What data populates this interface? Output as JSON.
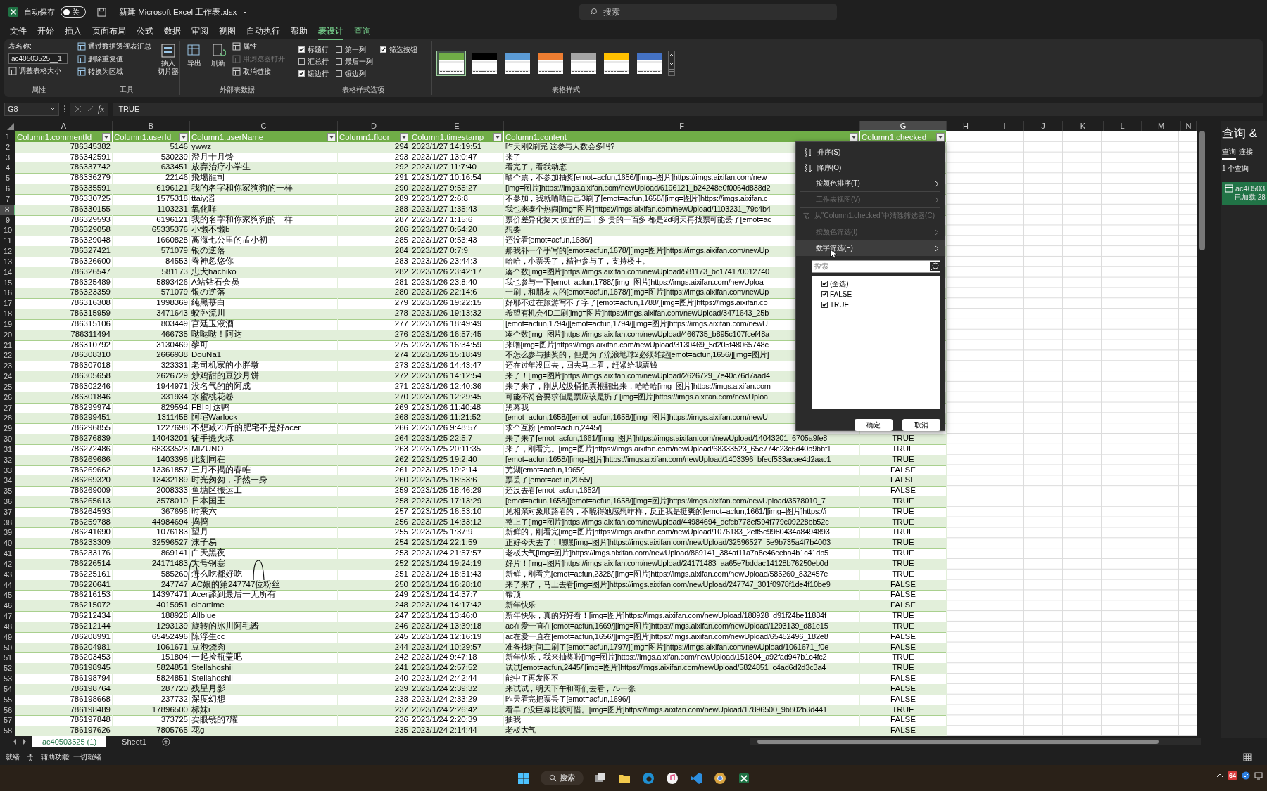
{
  "title_bar": {
    "autosave_label": "自动保存",
    "autosave_toggle": {
      "label": "关",
      "on": false
    },
    "file_title": "新建 Microsoft Excel 工作表.xlsx",
    "search_placeholder": "搜索"
  },
  "menu_tabs": [
    {
      "label": "文件",
      "selected": false,
      "contextual": false
    },
    {
      "label": "开始",
      "selected": false,
      "contextual": false
    },
    {
      "label": "插入",
      "selected": false,
      "contextual": false
    },
    {
      "label": "页面布局",
      "selected": false,
      "contextual": false
    },
    {
      "label": "公式",
      "selected": false,
      "contextual": false
    },
    {
      "label": "数据",
      "selected": false,
      "contextual": false
    },
    {
      "label": "审阅",
      "selected": false,
      "contextual": false
    },
    {
      "label": "视图",
      "selected": false,
      "contextual": false
    },
    {
      "label": "自动执行",
      "selected": false,
      "contextual": false
    },
    {
      "label": "帮助",
      "selected": false,
      "contextual": false
    },
    {
      "label": "表设计",
      "selected": true,
      "contextual": true
    },
    {
      "label": "查询",
      "selected": false,
      "contextual": true
    }
  ],
  "ribbon": {
    "properties_group": {
      "label": "属性",
      "table_name_label": "表名称:",
      "table_name": "ac40503525__1",
      "resize": "调整表格大小"
    },
    "tools_group": {
      "label": "工具",
      "items": [
        "通过数据透视表汇总",
        "删除重复值",
        "转换为区域"
      ],
      "slicer_lines": [
        "插入",
        "切片器"
      ]
    },
    "external_data_group": {
      "label": "外部表数据",
      "export": "导出",
      "refresh": "刷新",
      "items": [
        {
          "label": "属性",
          "disabled": false
        },
        {
          "label": "用浏览器打开",
          "disabled": true
        },
        {
          "label": "取消链接",
          "disabled": false
        }
      ]
    },
    "style_options_group": {
      "label": "表格样式选项",
      "options": [
        {
          "label": "标题行",
          "checked": true
        },
        {
          "label": "汇总行",
          "checked": false
        },
        {
          "label": "镶边行",
          "checked": true
        },
        {
          "label": "第一列",
          "checked": false
        },
        {
          "label": "最后一列",
          "checked": false
        },
        {
          "label": "镶边列",
          "checked": false
        },
        {
          "label": "筛选按钮",
          "checked": true
        }
      ]
    },
    "styles_group": {
      "label": "表格样式",
      "swatches": [
        {
          "color": "#70ad47",
          "selected": true
        },
        {
          "color": "#000000",
          "selected": false
        },
        {
          "color": "#5b9bd5",
          "selected": false
        },
        {
          "color": "#ed7d31",
          "selected": false
        },
        {
          "color": "#a5a5a5",
          "selected": false
        },
        {
          "color": "#ffc000",
          "selected": false
        },
        {
          "color": "#4472c4",
          "selected": false
        }
      ]
    }
  },
  "formula_bar": {
    "name_box": "G8",
    "function_label": "fx",
    "formula": "TRUE"
  },
  "column_letters": [
    {
      "letter": "A",
      "selected": false
    },
    {
      "letter": "B",
      "selected": false
    },
    {
      "letter": "C",
      "selected": false
    },
    {
      "letter": "D",
      "selected": false
    },
    {
      "letter": "E",
      "selected": false
    },
    {
      "letter": "F",
      "selected": false
    },
    {
      "letter": "G",
      "selected": true
    },
    {
      "letter": "H",
      "selected": false
    },
    {
      "letter": "I",
      "selected": false
    },
    {
      "letter": "J",
      "selected": false
    },
    {
      "letter": "K",
      "selected": false
    },
    {
      "letter": "L",
      "selected": false
    },
    {
      "letter": "M",
      "selected": false
    },
    {
      "letter": "N",
      "selected": false
    }
  ],
  "table": {
    "header_row_number": "1",
    "columns": [
      "Column1.commentId",
      "Column1.userId",
      "Column1.userName",
      "Column1.floor",
      "Column1.timestamp",
      "Column1.content",
      "Column1.checked"
    ],
    "rows": [
      {
        "number": "2",
        "selected": false,
        "cells": [
          "786345382",
          "5146",
          "ywwz",
          "294",
          "2023/1/27 14:19:51",
          "昨天刚2刷完 这参与人数会多吗?"
        ]
      },
      {
        "number": "3",
        "selected": false,
        "cells": [
          "786342591",
          "530239",
          "澄月十月铃",
          "293",
          "2023/1/27 13:0:47",
          "来了"
        ]
      },
      {
        "number": "4",
        "selected": false,
        "cells": [
          "786337742",
          "633451",
          "放弃治疗小学生",
          "292",
          "2023/1/27 11:7:40",
          "看完了，看我动态"
        ]
      },
      {
        "number": "5",
        "selected": false,
        "cells": [
          "786336279",
          "22146",
          "飛場龍司",
          "291",
          "2023/1/27 10:16:54",
          "晒个票，不参加抽奖[emot=acfun,1656/][img=图片]https://imgs.aixifan.com/new"
        ]
      },
      {
        "number": "6",
        "selected": false,
        "cells": [
          "786335591",
          "6196121",
          "我的名字和你家狗狗的一样",
          "290",
          "2023/1/27 9:55:27",
          "[img=图片]https://imgs.aixifan.com/newUpload/6196121_b24248e0f0064d838d2"
        ]
      },
      {
        "number": "7",
        "selected": false,
        "cells": [
          "786330725",
          "1575318",
          "ttaiy滔",
          "289",
          "2023/1/27 2:6:8",
          "不参加，我就晒晒自己3刷了[emot=acfun,1658/][img=图片]https://imgs.aixifan.c"
        ]
      },
      {
        "number": "8",
        "selected": true,
        "cells": [
          "786330155",
          "1103231",
          "氧化咩",
          "288",
          "2023/1/27 1:35:43",
          "我也来凑个热闹[img=图片]https://imgs.aixifan.com/newUpload/1103231_79c4b4"
        ]
      },
      {
        "number": "9",
        "selected": false,
        "cells": [
          "786329593",
          "6196121",
          "我的名字和你家狗狗的一样",
          "287",
          "2023/1/27 1:15:6",
          "票价差异化挺大 便宜的三十多 贵的一百多 都是2d明天再找票可能丢了[emot=ac"
        ]
      },
      {
        "number": "10",
        "selected": false,
        "cells": [
          "786329058",
          "65335376",
          "小懒不懒b",
          "286",
          "2023/1/27 0:54:20",
          "想要"
        ]
      },
      {
        "number": "11",
        "selected": false,
        "cells": [
          "786329048",
          "1660828",
          "离海七公里的孟小初",
          "285",
          "2023/1/27 0:53:43",
          "还没看[emot=acfun,1686/]"
        ]
      },
      {
        "number": "12",
        "selected": false,
        "cells": [
          "786327421",
          "571079",
          "银の逆落",
          "284",
          "2023/1/27 0:7:9",
          "那我补一个手写的[emot=acfun,1678/][img=图片]https://imgs.aixifan.com/newUp"
        ]
      },
      {
        "number": "13",
        "selected": false,
        "cells": [
          "786326600",
          "84553",
          "春神忽悠你",
          "283",
          "2023/1/26 23:44:3",
          "哈哈，小票丢了，精神参与了，支持楼主。"
        ]
      },
      {
        "number": "14",
        "selected": false,
        "cells": [
          "786326547",
          "581173",
          "忠犬hachiko",
          "282",
          "2023/1/26 23:42:17",
          "凑个数[img=图片]https://imgs.aixifan.com/newUpload/581173_bc174170012740"
        ]
      },
      {
        "number": "15",
        "selected": false,
        "cells": [
          "786325489",
          "5893426",
          "A站钻石会员",
          "281",
          "2023/1/26 23:8:40",
          "我也参与一下[emot=acfun,1788/][img=图片]https://imgs.aixifan.com/newUploa"
        ]
      },
      {
        "number": "16",
        "selected": false,
        "cells": [
          "786323359",
          "571079",
          "银の逆落",
          "280",
          "2023/1/26 22:14:6",
          "一刷，和朋友去的[emot=acfun,1678/][img=图片]https://imgs.aixifan.com/newUp"
        ]
      },
      {
        "number": "17",
        "selected": false,
        "cells": [
          "786316308",
          "1998369",
          "纯黑慕白",
          "279",
          "2023/1/26 19:22:15",
          "好耶不过在旅游写不了字了[emot=acfun,1788/][img=图片]https://imgs.aixifan.co"
        ]
      },
      {
        "number": "18",
        "selected": false,
        "cells": [
          "786315959",
          "3471643",
          "蛟卧流川",
          "278",
          "2023/1/26 19:13:32",
          "希望有机会4D二刷[img=图片]https://imgs.aixifan.com/newUpload/3471643_25b"
        ]
      },
      {
        "number": "19",
        "selected": false,
        "cells": [
          "786315106",
          "803449",
          "宫廷玉液酒",
          "277",
          "2023/1/26 18:49:49",
          "[emot=acfun,1794/][emot=acfun,1794/][img=图片]https://imgs.aixifan.com/newU"
        ]
      },
      {
        "number": "20",
        "selected": false,
        "cells": [
          "786311494",
          "466735",
          "哒哒哒！阿达",
          "276",
          "2023/1/26 16:57:45",
          "凑个数[img=图片]https://imgs.aixifan.com/newUpload/466735_b895c107fcef48a"
        ]
      },
      {
        "number": "21",
        "selected": false,
        "cells": [
          "786310792",
          "3130469",
          "黎可",
          "275",
          "2023/1/26 16:34:59",
          "来噜[img=图片]https://imgs.aixifan.com/newUpload/3130469_5d205f48065748c"
        ]
      },
      {
        "number": "22",
        "selected": false,
        "cells": [
          "786308310",
          "2666938",
          "DouNa1",
          "274",
          "2023/1/26 15:18:49",
          "不怎么参与抽奖的，但是为了流浪地球2必须雄起[emot=acfun,1656/][img=图片]"
        ]
      },
      {
        "number": "23",
        "selected": false,
        "cells": [
          "786307018",
          "323331",
          "老司机家的小胖墩",
          "273",
          "2023/1/26 14:43:47",
          "还在过年没回去，回去马上看，赶紧给我票钱"
        ]
      },
      {
        "number": "24",
        "selected": false,
        "cells": [
          "786305658",
          "2626729",
          "炒鸡甜的豆沙月饼",
          "272",
          "2023/1/26 14:12:54",
          "来了！[img=图片]https://imgs.aixifan.com/newUpload/2626729_7e40c76d7aad4"
        ]
      },
      {
        "number": "25",
        "selected": false,
        "cells": [
          "786302246",
          "1944971",
          "没名气的的阿成",
          "271",
          "2023/1/26 12:40:36",
          "来了来了，刚从垃圾桶把票根翻出来，哈哈哈[img=图片]https://imgs.aixifan.com"
        ]
      },
      {
        "number": "26",
        "selected": false,
        "cells": [
          "786301846",
          "331934",
          "水蜜桃花卷",
          "270",
          "2023/1/26 12:29:45",
          "可能不符合要求但是票应该是扔了[img=图片]https://imgs.aixifan.com/newUploa"
        ]
      },
      {
        "number": "27",
        "selected": false,
        "cells": [
          "786299974",
          "829594",
          "FBI可达鸭",
          "269",
          "2023/1/26 11:40:48",
          "黑幕我"
        ]
      },
      {
        "number": "28",
        "selected": false,
        "cells": [
          "786299451",
          "1311458",
          "阿宅Warlock",
          "268",
          "2023/1/26 11:21:52",
          "[emot=acfun,1658/][emot=acfun,1658/][img=图片]https://imgs.aixifan.com/newU"
        ]
      },
      {
        "number": "29",
        "selected": false,
        "cells": [
          "786296855",
          "1227698",
          "不想减20斤的肥宅不是好acer",
          "266",
          "2023/1/26 9:48:57",
          "求个互粉 [emot=acfun,2445/]"
        ]
      },
      {
        "number": "30",
        "selected": false,
        "cells": [
          "786276839",
          "14043201",
          "徒手撮火球",
          "264",
          "2023/1/25 22:5:7",
          "来了来了[emot=acfun,1661/][img=图片]https://imgs.aixifan.com/newUpload/14043201_6705a9fe8",
          "TRUE"
        ]
      },
      {
        "number": "31",
        "selected": false,
        "cells": [
          "786272486",
          "68333523",
          "MIZUNO",
          "263",
          "2023/1/25 20:11:35",
          "来了，刚看完。[img=图片]https://imgs.aixifan.com/newUpload/68333523_65e774c23c6d40b9bbf1",
          "TRUE"
        ]
      },
      {
        "number": "32",
        "selected": false,
        "cells": [
          "786269686",
          "1403396",
          "此刻同在",
          "262",
          "2023/1/25 19:2:40",
          "[emot=acfun,1658/][img=图片]https://imgs.aixifan.com/newUpload/1403396_bfecf533acae4d2aac1",
          "TRUE"
        ]
      },
      {
        "number": "33",
        "selected": false,
        "cells": [
          "786269662",
          "13361857",
          "三月不揭的春帷",
          "261",
          "2023/1/25 19:2:14",
          "芜湖[emot=acfun,1965/]",
          "FALSE"
        ]
      },
      {
        "number": "34",
        "selected": false,
        "cells": [
          "786269320",
          "13432189",
          "时光匆匆，孑然一身",
          "260",
          "2023/1/25 18:53:6",
          "票丢了[emot=acfun,2055/]",
          "FALSE"
        ]
      },
      {
        "number": "35",
        "selected": false,
        "cells": [
          "786269009",
          "2008333",
          "鱼塘区搬运工",
          "259",
          "2023/1/25 18:46:29",
          "还没去看[emot=acfun,1652/]",
          "FALSE"
        ]
      },
      {
        "number": "36",
        "selected": false,
        "cells": [
          "786265613",
          "3578010",
          "日本国王",
          "258",
          "2023/1/25 17:13:29",
          "[emot=acfun,1658/][emot=acfun,1658/][img=图片]https://imgs.aixifan.com/newUpload/3578010_7",
          "TRUE"
        ]
      },
      {
        "number": "37",
        "selected": false,
        "cells": [
          "786264593",
          "367696",
          "时乘六",
          "257",
          "2023/1/25 16:53:10",
          "见相亲对象顺路看的，不晓得她感想咋样，反正我是挺爽的[emot=acfun,1661/][img=图片]https://i",
          "TRUE"
        ]
      },
      {
        "number": "38",
        "selected": false,
        "cells": [
          "786259788",
          "44984694",
          "捣捣",
          "256",
          "2023/1/25 14:33:12",
          "整上了[img=图片]https://imgs.aixifan.com/newUpload/44984694_dcfcb778ef594f779c09228bb52c",
          "TRUE"
        ]
      },
      {
        "number": "39",
        "selected": false,
        "cells": [
          "786241690",
          "1076183",
          "望月",
          "255",
          "2023/1/25 1:37:9",
          "新鲜的，刚看完[img=图片]https://imgs.aixifan.com/newUpload/1076183_2eff5e9980434a8494893",
          "TRUE"
        ]
      },
      {
        "number": "40",
        "selected": false,
        "cells": [
          "786233309",
          "32596527",
          "沫子易",
          "254",
          "2023/1/24 22:1:59",
          "正好今天去了！嘿嘿[img=图片]https://imgs.aixifan.com/newUpload/32596527_5e9b735a4f7b4003",
          "TRUE"
        ]
      },
      {
        "number": "41",
        "selected": false,
        "cells": [
          "786233176",
          "869141",
          "白天黑夜",
          "253",
          "2023/1/24 21:57:57",
          "老板大气[img=图片]https://imgs.aixifan.com/newUpload/869141_384af11a7a8e46ceba4b1c41db5",
          "TRUE"
        ]
      },
      {
        "number": "42",
        "selected": false,
        "cells": [
          "786226514",
          "24171483",
          "大号钢塞",
          "252",
          "2023/1/24 19:24:19",
          "好片！[img=图片]https://imgs.aixifan.com/newUpload/24171483_aa65e7bddac14128b76250eb0d",
          "TRUE"
        ]
      },
      {
        "number": "43",
        "selected": false,
        "cells": [
          "786225161",
          "585260",
          "怎么吃都好吃",
          "251",
          "2023/1/24 18:51:43",
          "新鲜，刚看完[emot=acfun,2328/][img=图片]https://imgs.aixifan.com/newUpload/585260_832457e",
          "TRUE"
        ]
      },
      {
        "number": "44",
        "selected": false,
        "cells": [
          "786220641",
          "247747",
          "AC娘的第247747位粉丝",
          "250",
          "2023/1/24 16:28:10",
          "来了来了，马上去看[img=图片]https://imgs.aixifan.com/newUpload/247747_301f0978f1de4f10be9",
          "FALSE"
        ]
      },
      {
        "number": "45",
        "selected": false,
        "cells": [
          "786216153",
          "14397471",
          "Acer舔到最后一无所有",
          "249",
          "2023/1/24 14:37:7",
          "帮顶",
          "FALSE"
        ]
      },
      {
        "number": "46",
        "selected": false,
        "cells": [
          "786215072",
          "4015951",
          "cleartime",
          "248",
          "2023/1/24 14:17:42",
          "新年快乐",
          "FALSE"
        ]
      },
      {
        "number": "47",
        "selected": false,
        "cells": [
          "786212434",
          "188928",
          "Allblue",
          "247",
          "2023/1/24 13:46:0",
          "新年快乐，真的好好看！[img=图片]https://imgs.aixifan.com/newUpload/188928_d91f24be11884f",
          "TRUE"
        ]
      },
      {
        "number": "48",
        "selected": false,
        "cells": [
          "786212144",
          "1293139",
          "旋转的冰川阿毛酱",
          "246",
          "2023/1/24 13:39:18",
          "ac在爱一直在[emot=acfun,1669/][img=图片]https://imgs.aixifan.com/newUpload/1293139_d81e15",
          "TRUE"
        ]
      },
      {
        "number": "49",
        "selected": false,
        "cells": [
          "786208991",
          "65452496",
          "陈浮生cc",
          "245",
          "2023/1/24 12:16:19",
          "ac在爱一直在[emot=acfun,1656/][img=图片]https://imgs.aixifan.com/newUpload/65452496_182e8",
          "FALSE"
        ]
      },
      {
        "number": "50",
        "selected": false,
        "cells": [
          "786204981",
          "1061671",
          "豆泡烧肉",
          "244",
          "2023/1/24 10:29:57",
          "准备找时间二刷了[emot=acfun,1797/][img=图片]https://imgs.aixifan.com/newUpload/1061671_f0e",
          "FALSE"
        ]
      },
      {
        "number": "51",
        "selected": false,
        "cells": [
          "786203453",
          "151804",
          "一起捡瓶盖吧",
          "242",
          "2023/1/24 9:47:18",
          "新年快乐，我来抽奖啦[img=图片]https://imgs.aixifan.com/newUpload/151804_a92fad947b1c4fc2",
          "TRUE"
        ]
      },
      {
        "number": "52",
        "selected": false,
        "cells": [
          "786198945",
          "5824851",
          "Stellahoshii",
          "241",
          "2023/1/24 2:57:52",
          "试试[emot=acfun,2445/][img=图片]https://imgs.aixifan.com/newUpload/5824851_c4ad6d2d3c3a4",
          "TRUE"
        ]
      },
      {
        "number": "53",
        "selected": false,
        "cells": [
          "786198794",
          "5824851",
          "Stellahoshii",
          "240",
          "2023/1/24 2:42:44",
          "能中了再发图不",
          "FALSE"
        ]
      },
      {
        "number": "54",
        "selected": false,
        "cells": [
          "786198764",
          "287720",
          "残星月影",
          "239",
          "2023/1/24 2:39:32",
          "来试试，明天下午和哥们去看，75一张",
          "FALSE"
        ]
      },
      {
        "number": "55",
        "selected": false,
        "cells": [
          "786198668",
          "237732",
          "深度幻想",
          "238",
          "2023/1/24 2:33:29",
          "昨天看完把票丢了[emot=acfun,1696/]",
          "FALSE"
        ]
      },
      {
        "number": "56",
        "selected": false,
        "cells": [
          "786198489",
          "17896500",
          "标妹i",
          "237",
          "2023/1/24 2:26:42",
          "看早了没巨幕比较可惜。[img=图片]https://imgs.aixifan.com/newUpload/17896500_9b802b3d441",
          "TRUE"
        ]
      },
      {
        "number": "57",
        "selected": false,
        "cells": [
          "786197848",
          "373725",
          "卖眼镜的7耀",
          "236",
          "2023/1/24 2:20:39",
          "抽我",
          "FALSE"
        ]
      },
      {
        "number": "58",
        "selected": false,
        "cells": [
          "786197626",
          "7805765",
          "花g",
          "235",
          "2023/1/24 2:14:44",
          "老板大气",
          "FALSE"
        ]
      }
    ]
  },
  "filter_menu": {
    "items": [
      {
        "kind": "sort_asc",
        "label": "升序(S)",
        "disabled": false,
        "highlighted": false
      },
      {
        "kind": "sort_desc",
        "label": "降序(O)",
        "disabled": false,
        "highlighted": false
      },
      {
        "kind": "submenu",
        "label": "按颜色排序(T)",
        "disabled": false,
        "highlighted": false
      },
      {
        "kind": "submenu",
        "label": "工作表视图(V)",
        "disabled": true,
        "highlighted": false
      },
      {
        "kind": "clear",
        "label": "从\"Column1.checked\"中清除筛选器(C)",
        "disabled": true,
        "highlighted": false
      },
      {
        "kind": "submenu",
        "label": "按颜色筛选(I)",
        "disabled": true,
        "highlighted": false
      },
      {
        "kind": "submenu",
        "label": "数字筛选(F)",
        "disabled": false,
        "highlighted": true
      }
    ],
    "search_placeholder": "搜索",
    "values": [
      {
        "label": "(全选)",
        "checked": true
      },
      {
        "label": "FALSE",
        "checked": true
      },
      {
        "label": "TRUE",
        "checked": true
      }
    ],
    "buttons": [
      "确定",
      "取消"
    ]
  },
  "sheet_tabs": [
    {
      "label": "ac40503525 (1)",
      "selected": true
    },
    {
      "label": "Sheet1",
      "selected": false
    }
  ],
  "status_bar": {
    "ready": "就绪",
    "accessibility": "辅助功能: 一切就绪"
  },
  "task_pane": {
    "title": "查询 &",
    "tabs": [
      {
        "label": "查询",
        "selected": true
      },
      {
        "label": "连接",
        "selected": false
      }
    ],
    "count": "1 个查询",
    "query": {
      "name": "ac40503",
      "status": "已加载 28"
    }
  },
  "taskbar": {
    "search": "搜索",
    "tray_badge": "64"
  }
}
